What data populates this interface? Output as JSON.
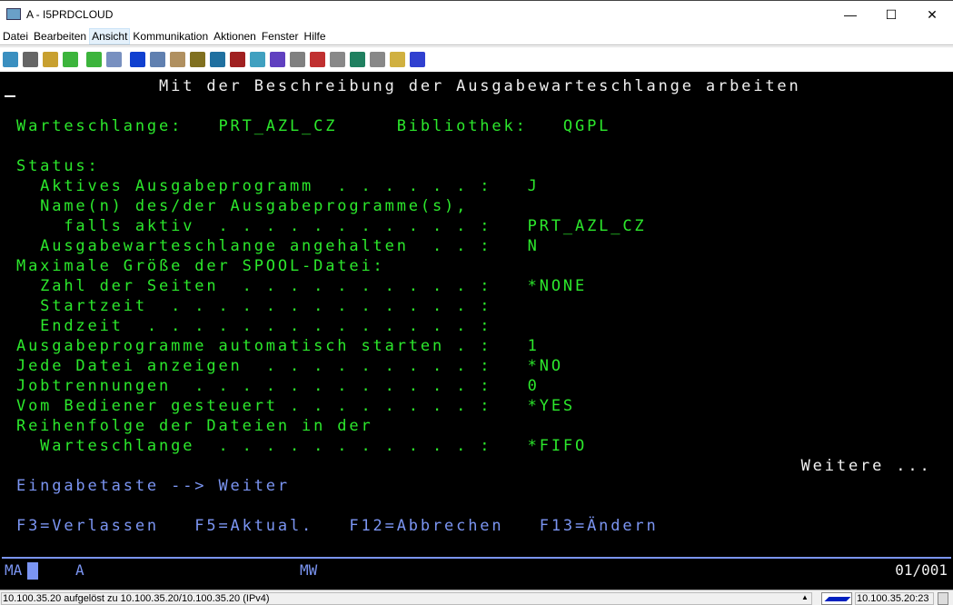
{
  "window": {
    "title": "A - I5PRDCLOUD",
    "minimize": "—",
    "maximize": "☐",
    "close": "✕"
  },
  "menu": [
    "Datei",
    "Bearbeiten",
    "Ansicht",
    "Kommunikation",
    "Aktionen",
    "Fenster",
    "Hilfe"
  ],
  "toolbar_icons": [
    "print-screen-icon",
    "copy-icon",
    "paste-icon",
    "send-file-icon",
    "receive-file-icon",
    "display-file-icon",
    "compass-icon",
    "window-icon",
    "notes-icon",
    "package-icon",
    "settings-icon",
    "sql-icon",
    "screen-icon",
    "color-grid-icon",
    "keyboard-map-icon",
    "record-macro-icon",
    "stop-macro-icon",
    "play-macro-icon",
    "pause-macro-icon",
    "notepad-icon",
    "help-icon"
  ],
  "screen": {
    "lines": [
      "            Mit der Beschreibung der Ausgabewarteschlange arbeiten",
      "Warteschlange:   PRT_AZL_CZ     Bibliothek:   QGPL",
      "Status:",
      "  Aktives Ausgabeprogramm  . . . . . . :   J",
      "  Name(n) des/der Ausgabeprogramme(s),",
      "    falls aktiv  . . . . . . . . . . . :   PRT_AZL_CZ",
      "  Ausgabewarteschlange angehalten  . . :   N",
      "Maximale Größe der SPOOL-Datei:",
      "  Zahl der Seiten  . . . . . . . . . . :   *NONE",
      "  Startzeit  . . . . . . . . . . . . . :",
      "  Endzeit  . . . . . . . . . . . . . . :",
      "Ausgabeprogramme automatisch starten . :   1",
      "Jede Datei anzeigen  . . . . . . . . . :   *NO",
      "Jobtrennungen  . . . . . . . . . . . . :   0",
      "Vom Bediener gesteuert . . . . . . . . :   *YES",
      "Reihenfolge der Dateien in der",
      "  Warteschlange  . . . . . . . . . . . :   *FIFO",
      "                                                                  Weitere ...",
      "Eingabetaste --> Weiter",
      "F3=Verlassen   F5=Aktual.   F12=Abbrechen   F13=Ändern"
    ],
    "oia": {
      "mode": "MA",
      "session": "A",
      "mw": "MW",
      "position": "01/001"
    }
  },
  "statusbar": {
    "message": "10.100.35.20 aufgelöst zu 10.100.35.20/10.100.35.20 (IPv4)",
    "host": "10.100.35.20:23"
  },
  "colors": {
    "green": "#2ce82c",
    "blue": "#7b95f2",
    "white": "#f0f0f0",
    "background": "#000000"
  }
}
